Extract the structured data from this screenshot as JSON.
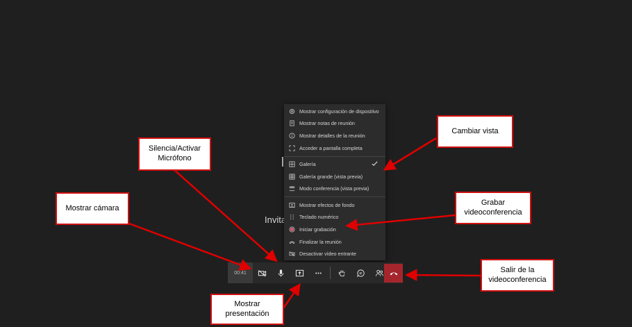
{
  "background": {
    "partial_text": "Invita"
  },
  "menu": {
    "items": [
      {
        "label": "Mostrar configuración de dispositivo",
        "icon": "gear-icon"
      },
      {
        "label": "Mostrar notas de reunión",
        "icon": "notes-icon"
      },
      {
        "label": "Mostrar detalles de la reunión",
        "icon": "info-icon"
      },
      {
        "label": "Acceder a pantalla completa",
        "icon": "fullscreen-icon"
      },
      {
        "label": "Galería",
        "icon": "gallery-icon",
        "checked": true
      },
      {
        "label": "Galería grande (vista previa)",
        "icon": "large-gallery-icon"
      },
      {
        "label": "Modo conferencia (vista previa)",
        "icon": "conference-mode-icon"
      },
      {
        "label": "Mostrar efectos de fondo",
        "icon": "background-effects-icon"
      },
      {
        "label": "Teclado numérico",
        "icon": "keypad-icon"
      },
      {
        "label": "Iniciar grabación",
        "icon": "record-icon"
      },
      {
        "label": "Finalizar la reunión",
        "icon": "end-call-icon"
      },
      {
        "label": "Desactivar vídeo entrante",
        "icon": "video-off-icon"
      }
    ]
  },
  "toolbar": {
    "timer": "00:41",
    "buttons": [
      "camera-off-icon",
      "microphone-icon",
      "share-screen-icon",
      "more-icon",
      "raise-hand-icon",
      "chat-icon",
      "participants-icon",
      "hang-up-icon"
    ]
  },
  "callouts": {
    "cambiar_vista": "Cambiar vista",
    "silencia_line1": "Silencia/Activar",
    "silencia_line2": "Micrófono",
    "mostrar_camara": "Mostrar cámara",
    "grabar_line1": "Grabar",
    "grabar_line2": "videoconferencia",
    "salir_line1": "Salir de la",
    "salir_line2": "videoconferencia",
    "presentacion_line1": "Mostrar",
    "presentacion_line2": "presentación"
  },
  "colors": {
    "background": "#1f1f1f",
    "menu": "#2d2c2c",
    "toolbar": "#292929",
    "hangup": "#a4262c",
    "record": "#e05a72",
    "callout_border": "#d01010",
    "arrow": "#e00000"
  }
}
